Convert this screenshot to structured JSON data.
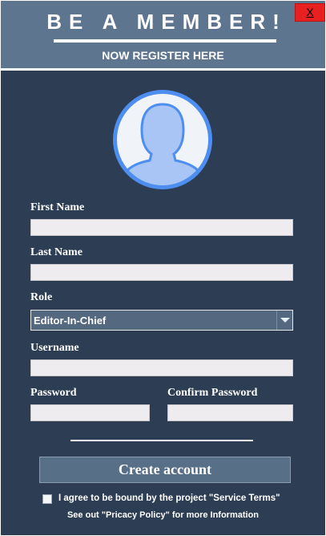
{
  "header": {
    "title": "BE A MEMBER!",
    "subtitle": "NOW REGISTER HERE",
    "close_label": "X"
  },
  "avatar": {
    "icon": "user-avatar-icon"
  },
  "form": {
    "first_name": {
      "label": "First Name",
      "value": ""
    },
    "last_name": {
      "label": "Last Name",
      "value": ""
    },
    "role": {
      "label": "Role",
      "selected": "Editor-In-Chief"
    },
    "username": {
      "label": "Username",
      "value": ""
    },
    "password": {
      "label": "Password",
      "value": ""
    },
    "confirm_password": {
      "label": "Confirm Password",
      "value": ""
    }
  },
  "actions": {
    "create_label": "Create account"
  },
  "footer": {
    "agree_text": "I agree to be bound by the project \"Service Terms\"",
    "privacy_text": "See out \"Pricacy Policy\"  for more Information",
    "agree_checked": false
  },
  "colors": {
    "header_bg": "#5e7590",
    "panel_bg": "#2d3e54",
    "close_bg": "#e8201f",
    "avatar_accent": "#4d8ef0",
    "input_bg": "#efecef"
  }
}
